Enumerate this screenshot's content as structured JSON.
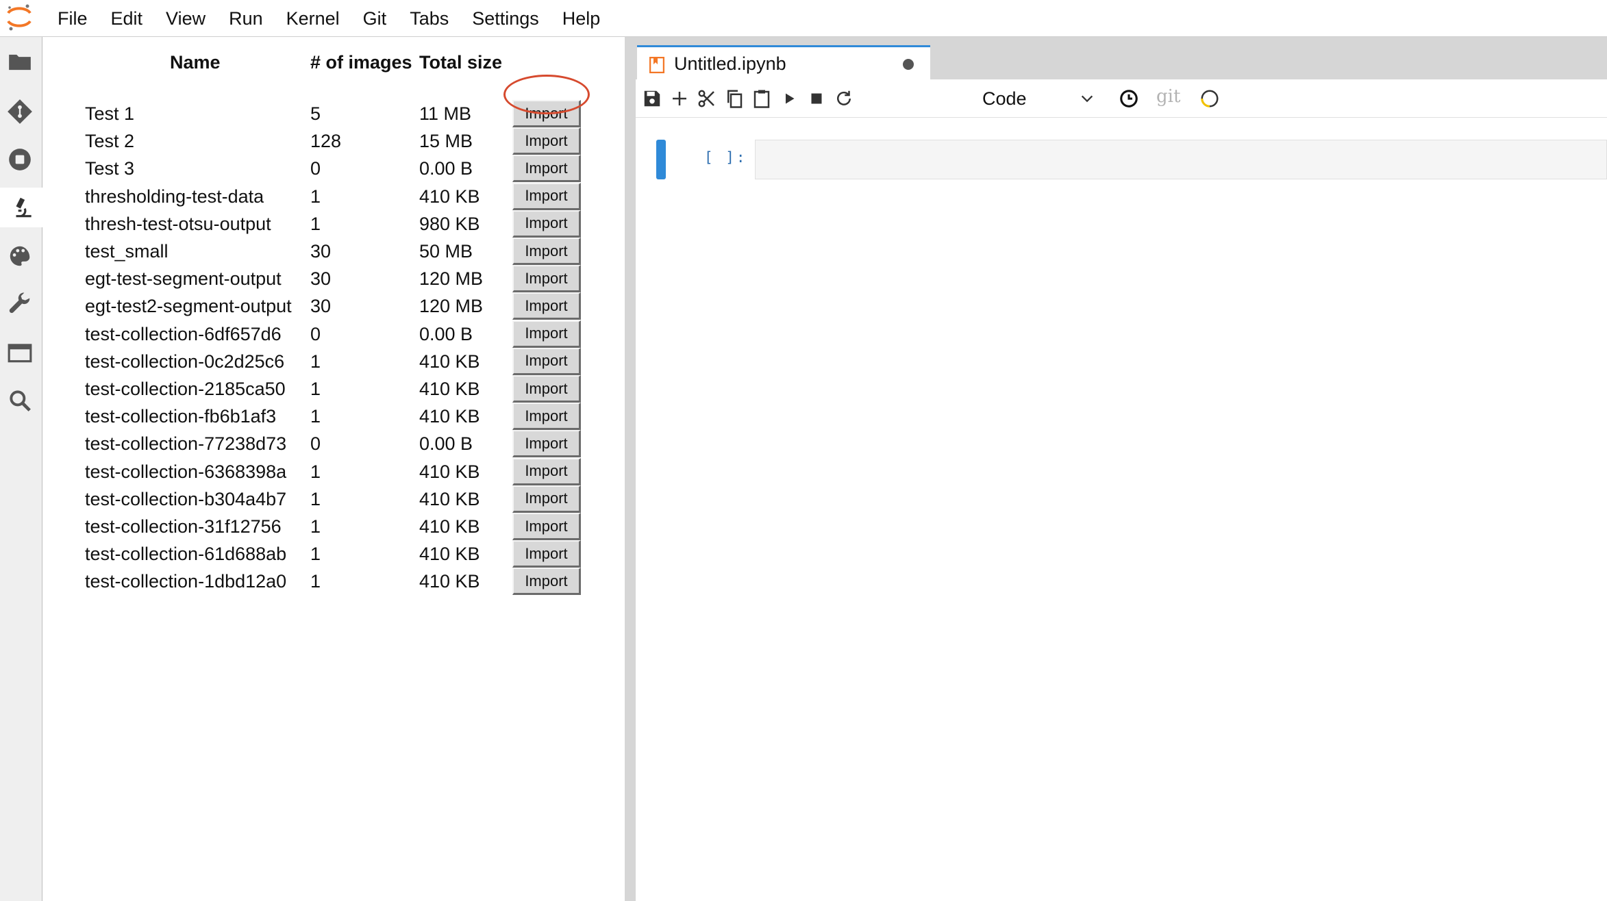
{
  "menubar": {
    "items": [
      "File",
      "Edit",
      "View",
      "Run",
      "Kernel",
      "Git",
      "Tabs",
      "Settings",
      "Help"
    ]
  },
  "activity_bar": {
    "icons": [
      "folder-icon",
      "git-icon",
      "stop-circle-icon",
      "microscope-icon",
      "palette-icon",
      "wrench-icon",
      "window-icon",
      "search-icon"
    ],
    "active": "microscope-icon"
  },
  "collections": {
    "headers": {
      "name": "Name",
      "count": "# of images",
      "size": "Total size"
    },
    "import_label": "Import",
    "rows": [
      {
        "name": "Test 1",
        "count": "5",
        "size": "11 MB"
      },
      {
        "name": "Test 2",
        "count": "128",
        "size": "15 MB"
      },
      {
        "name": "Test 3",
        "count": "0",
        "size": "0.00 B"
      },
      {
        "name": "thresholding-test-data",
        "count": "1",
        "size": "410 KB"
      },
      {
        "name": "thresh-test-otsu-output",
        "count": "1",
        "size": "980 KB"
      },
      {
        "name": "test_small",
        "count": "30",
        "size": "50 MB"
      },
      {
        "name": "egt-test-segment-output",
        "count": "30",
        "size": "120 MB"
      },
      {
        "name": "egt-test2-segment-output",
        "count": "30",
        "size": "120 MB"
      },
      {
        "name": "test-collection-6df657d6",
        "count": "0",
        "size": "0.00 B"
      },
      {
        "name": "test-collection-0c2d25c6",
        "count": "1",
        "size": "410 KB"
      },
      {
        "name": "test-collection-2185ca50",
        "count": "1",
        "size": "410 KB"
      },
      {
        "name": "test-collection-fb6b1af3",
        "count": "1",
        "size": "410 KB"
      },
      {
        "name": "test-collection-77238d73",
        "count": "0",
        "size": "0.00 B"
      },
      {
        "name": "test-collection-6368398a",
        "count": "1",
        "size": "410 KB"
      },
      {
        "name": "test-collection-b304a4b7",
        "count": "1",
        "size": "410 KB"
      },
      {
        "name": "test-collection-31f12756",
        "count": "1",
        "size": "410 KB"
      },
      {
        "name": "test-collection-61d688ab",
        "count": "1",
        "size": "410 KB"
      },
      {
        "name": "test-collection-1dbd12a0",
        "count": "1",
        "size": "410 KB"
      }
    ],
    "highlight_color": "#d64a2e"
  },
  "notebook": {
    "tab_title": "Untitled.ipynb",
    "toolbar_icons": [
      "save-icon",
      "add-cell-icon",
      "cut-icon",
      "copy-icon",
      "paste-icon",
      "run-icon",
      "stop-icon",
      "restart-icon"
    ],
    "cell_type": "Code",
    "git_label": "git",
    "prompt": "[ ]:",
    "accent_color": "#2f8ad8"
  }
}
